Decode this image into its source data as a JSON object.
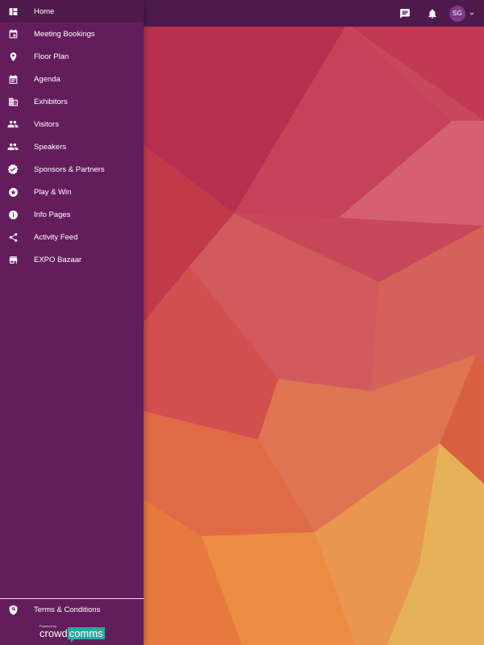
{
  "topbar": {
    "icons": [
      "chat-icon",
      "bell-icon",
      "chevron-down-icon"
    ],
    "avatar_initials": "SG"
  },
  "sidebar": {
    "items": [
      {
        "label": "Home",
        "icon": "dashboard-icon",
        "active": true
      },
      {
        "label": "Meeting Bookings",
        "icon": "calendar-event-icon"
      },
      {
        "label": "Floor Plan",
        "icon": "map-pin-icon"
      },
      {
        "label": "Agenda",
        "icon": "calendar-icon"
      },
      {
        "label": "Exhibitors",
        "icon": "building-icon"
      },
      {
        "label": "Visitors",
        "icon": "people-icon"
      },
      {
        "label": "Speakers",
        "icon": "people-icon"
      },
      {
        "label": "Sponsors & Partners",
        "icon": "verified-badge-icon"
      },
      {
        "label": "Play & Win",
        "icon": "star-circle-icon"
      },
      {
        "label": "Info Pages",
        "icon": "info-icon"
      },
      {
        "label": "Activity Feed",
        "icon": "share-icon"
      },
      {
        "label": "EXPO Bazaar",
        "icon": "store-icon"
      }
    ],
    "footer": {
      "terms_label": "Terms & Conditions",
      "terms_icon": "shield-icon",
      "powered_by": "Powered by",
      "brand_part1": "crowd",
      "brand_part2": "comms"
    }
  },
  "colors": {
    "sidebar_bg": "#641d5c",
    "topbar_bg": "#4e1a4b",
    "active_item_bg": "#4e1a4b",
    "avatar_bg": "#7d3a86",
    "brand_accent": "#2fa8a0"
  }
}
